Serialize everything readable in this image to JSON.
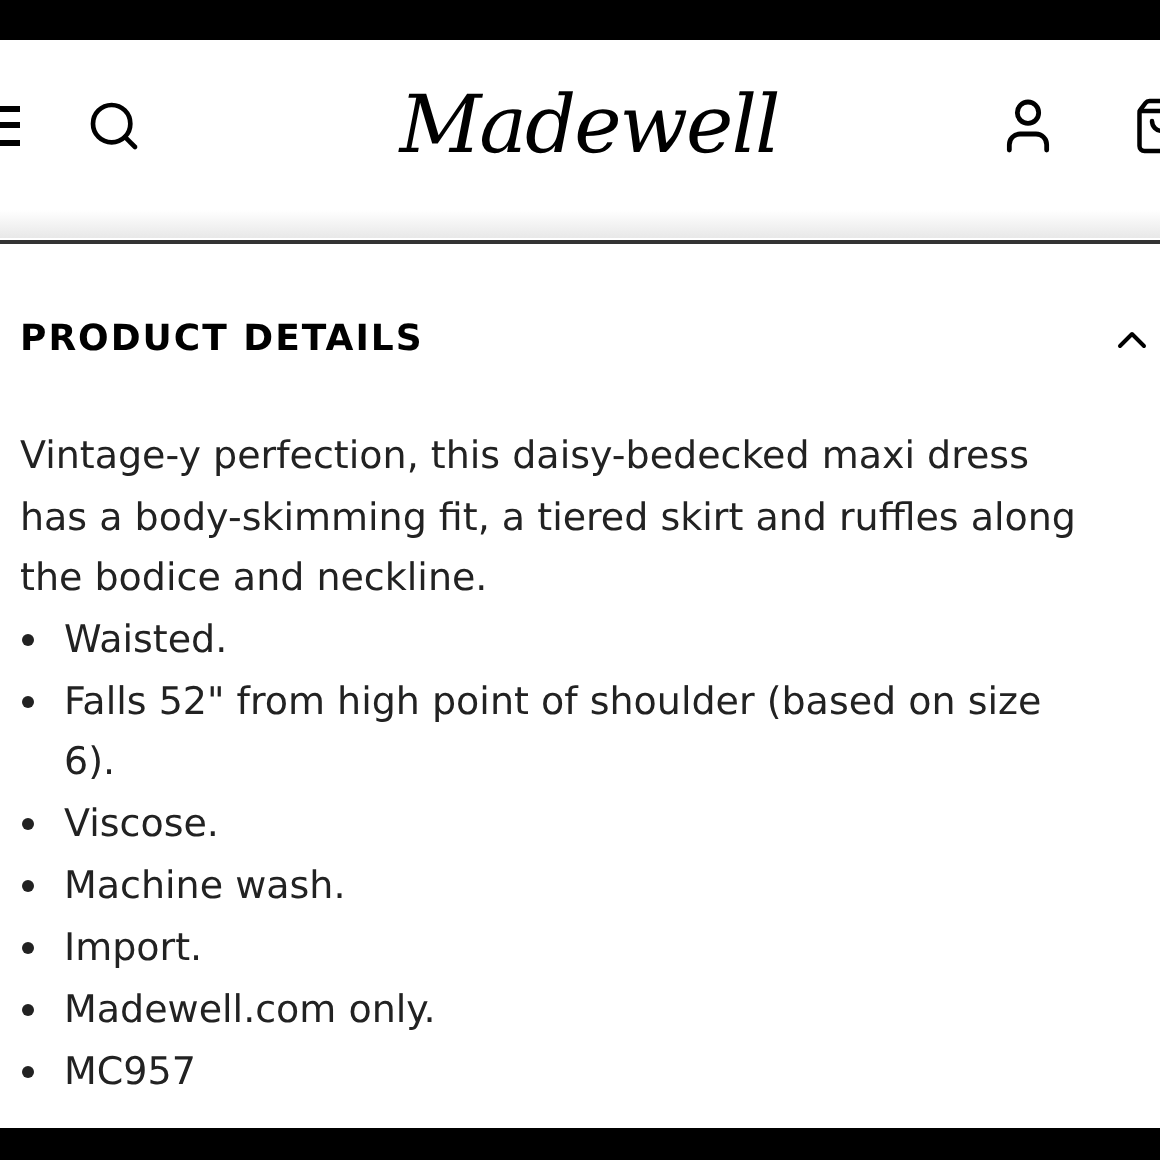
{
  "header": {
    "logo": "Madewell"
  },
  "section": {
    "title": "PRODUCT DETAILS",
    "expanded": true,
    "description": "Vintage-y perfection, this daisy-bedecked maxi dress has a body-skimming fit, a tiered skirt and ruffles along the bodice and neckline.",
    "bullets": [
      "Waisted.",
      "Falls 52\" from high point of shoulder (based on size 6).",
      "Viscose.",
      "Machine wash.",
      "Import.",
      "Madewell.com only.",
      "MC957"
    ]
  }
}
